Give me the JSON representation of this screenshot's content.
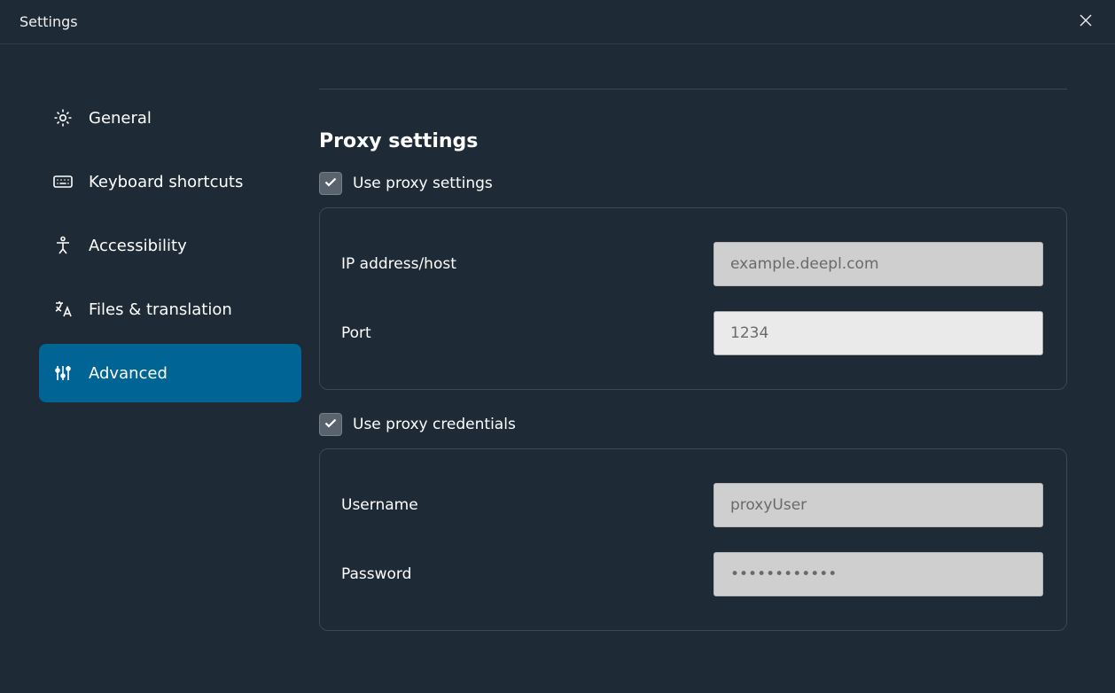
{
  "window": {
    "title": "Settings"
  },
  "sidebar": {
    "items": [
      {
        "id": "general",
        "label": "General",
        "icon": "gear-icon",
        "active": false
      },
      {
        "id": "shortcuts",
        "label": "Keyboard shortcuts",
        "icon": "keyboard-icon",
        "active": false
      },
      {
        "id": "a11y",
        "label": "Accessibility",
        "icon": "accessibility-icon",
        "active": false
      },
      {
        "id": "files",
        "label": "Files & translation",
        "icon": "translate-icon",
        "active": false
      },
      {
        "id": "advanced",
        "label": "Advanced",
        "icon": "sliders-icon",
        "active": true
      }
    ]
  },
  "main": {
    "section_title": "Proxy settings",
    "use_proxy": {
      "label": "Use proxy settings",
      "checked": true
    },
    "proxy": {
      "ip_label": "IP address/host",
      "ip_placeholder": "example.deepl.com",
      "ip_value": "",
      "port_label": "Port",
      "port_placeholder": "1234",
      "port_value": ""
    },
    "use_credentials": {
      "label": "Use proxy credentials",
      "checked": true
    },
    "credentials": {
      "user_label": "Username",
      "user_placeholder": "proxyUser",
      "user_value": "",
      "pass_label": "Password",
      "pass_placeholder": "••••••••••••",
      "pass_value": ""
    }
  }
}
